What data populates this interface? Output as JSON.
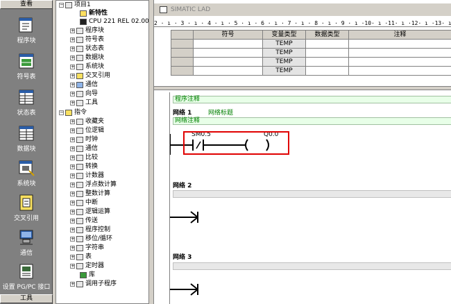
{
  "leftbar": {
    "header": "查看",
    "footer": "工具",
    "items": [
      {
        "label": "程序块",
        "icon": "program-block-icon"
      },
      {
        "label": "符号表",
        "icon": "symbol-table-icon"
      },
      {
        "label": "状态表",
        "icon": "status-table-icon"
      },
      {
        "label": "数据块",
        "icon": "data-block-icon"
      },
      {
        "label": "系统块",
        "icon": "system-block-icon"
      },
      {
        "label": "交叉引用",
        "icon": "cross-reference-icon"
      },
      {
        "label": "通信",
        "icon": "communication-icon"
      },
      {
        "label": "设置 PG/PC 接口",
        "icon": "pg-pc-interface-icon"
      }
    ]
  },
  "tree": {
    "nodes": [
      {
        "label": "项目1"
      },
      {
        "label": "新特性"
      },
      {
        "label": "CPU 221 REL 02.00"
      },
      {
        "label": "程序块"
      },
      {
        "label": "符号表"
      },
      {
        "label": "状态表"
      },
      {
        "label": "数据块"
      },
      {
        "label": "系统块"
      },
      {
        "label": "交叉引用"
      },
      {
        "label": "通信"
      },
      {
        "label": "向导"
      },
      {
        "label": "工具"
      },
      {
        "label": "指令"
      },
      {
        "label": "收藏夹"
      },
      {
        "label": "位逻辑"
      },
      {
        "label": "时钟"
      },
      {
        "label": "通信"
      },
      {
        "label": "比较"
      },
      {
        "label": "转换"
      },
      {
        "label": "计数器"
      },
      {
        "label": "浮点数计算"
      },
      {
        "label": "整数计算"
      },
      {
        "label": "中断"
      },
      {
        "label": "逻辑运算"
      },
      {
        "label": "传送"
      },
      {
        "label": "程序控制"
      },
      {
        "label": "移位/循环"
      },
      {
        "label": "字符串"
      },
      {
        "label": "表"
      },
      {
        "label": "定时器"
      },
      {
        "label": "库"
      },
      {
        "label": "调用子程序"
      }
    ]
  },
  "editor": {
    "title": "SIMATIC LAD",
    "ruler": "2 · ı · 3 · ı · 4 · ı · 5 · ı · 6 · ı · 7 · ı · 8 · ı · 9 · ı ·10· ı ·11· ı ·12· ı ·13· ı ·14· ı ·15· ı ·16",
    "table": {
      "headers": [
        "符号",
        "变量类型",
        "数据类型",
        "注释"
      ],
      "rows": [
        "TEMP",
        "TEMP",
        "TEMP",
        "TEMP"
      ]
    },
    "program_comment": "程序注释",
    "network1_label": "网络 1",
    "network1_title": "网络标题",
    "network_comment": "网络注释",
    "contact_address": "SM0.5",
    "coil_address": "Q0.0",
    "network2_label": "网络 2",
    "network3_label": "网络 3"
  }
}
